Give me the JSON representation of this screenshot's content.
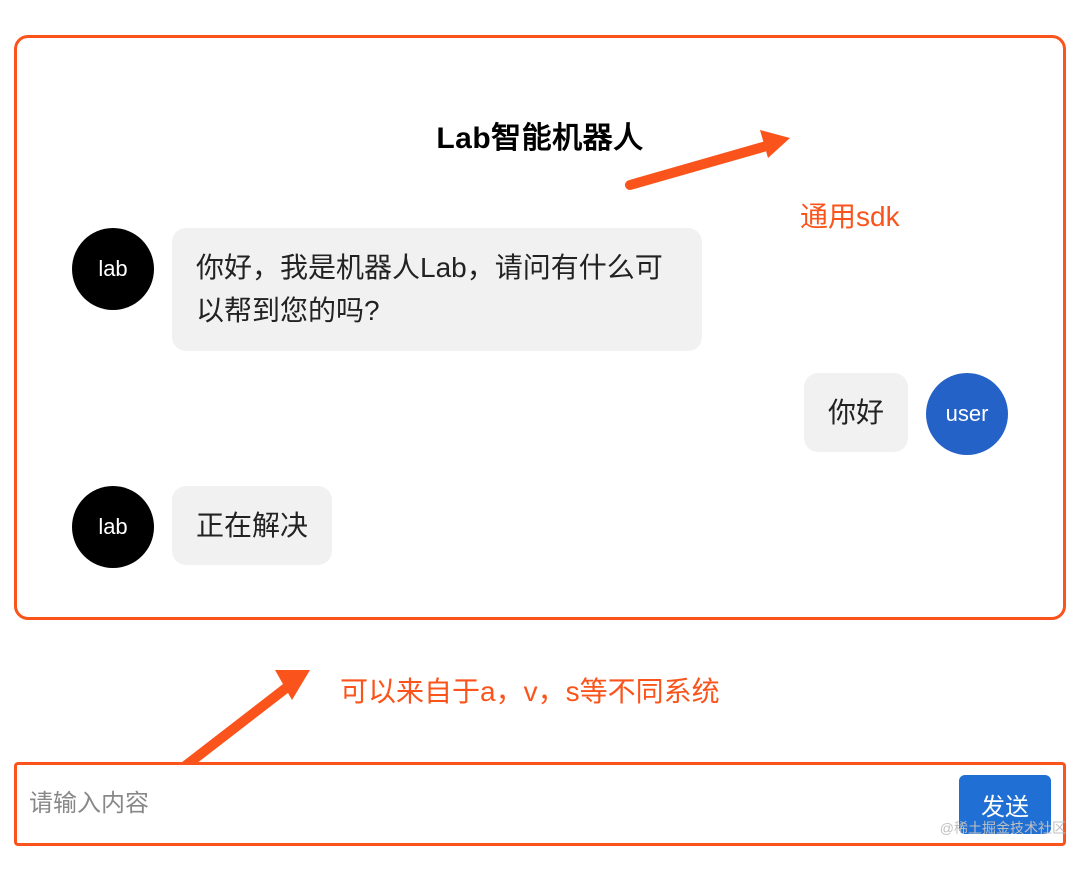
{
  "chat": {
    "title": "Lab智能机器人",
    "messages": [
      {
        "role": "lab",
        "avatar": "lab",
        "text": "你好，我是机器人Lab，请问有什么可以帮到您的吗?"
      },
      {
        "role": "user",
        "avatar": "user",
        "text": "你好"
      },
      {
        "role": "lab",
        "avatar": "lab",
        "text": "正在解决"
      }
    ]
  },
  "avatars": {
    "lab": {
      "label": "lab",
      "color": "#000000"
    },
    "user": {
      "label": "user",
      "color": "#2462c7"
    }
  },
  "input": {
    "placeholder": "请输入内容",
    "send_label": "发送"
  },
  "annotations": {
    "sdk": "通用sdk",
    "source": "可以来自于a，v，s等不同系统"
  },
  "colors": {
    "outline": "#fa541c",
    "send_button": "#1f6fd4"
  },
  "watermark": "@稀土掘金技术社区"
}
